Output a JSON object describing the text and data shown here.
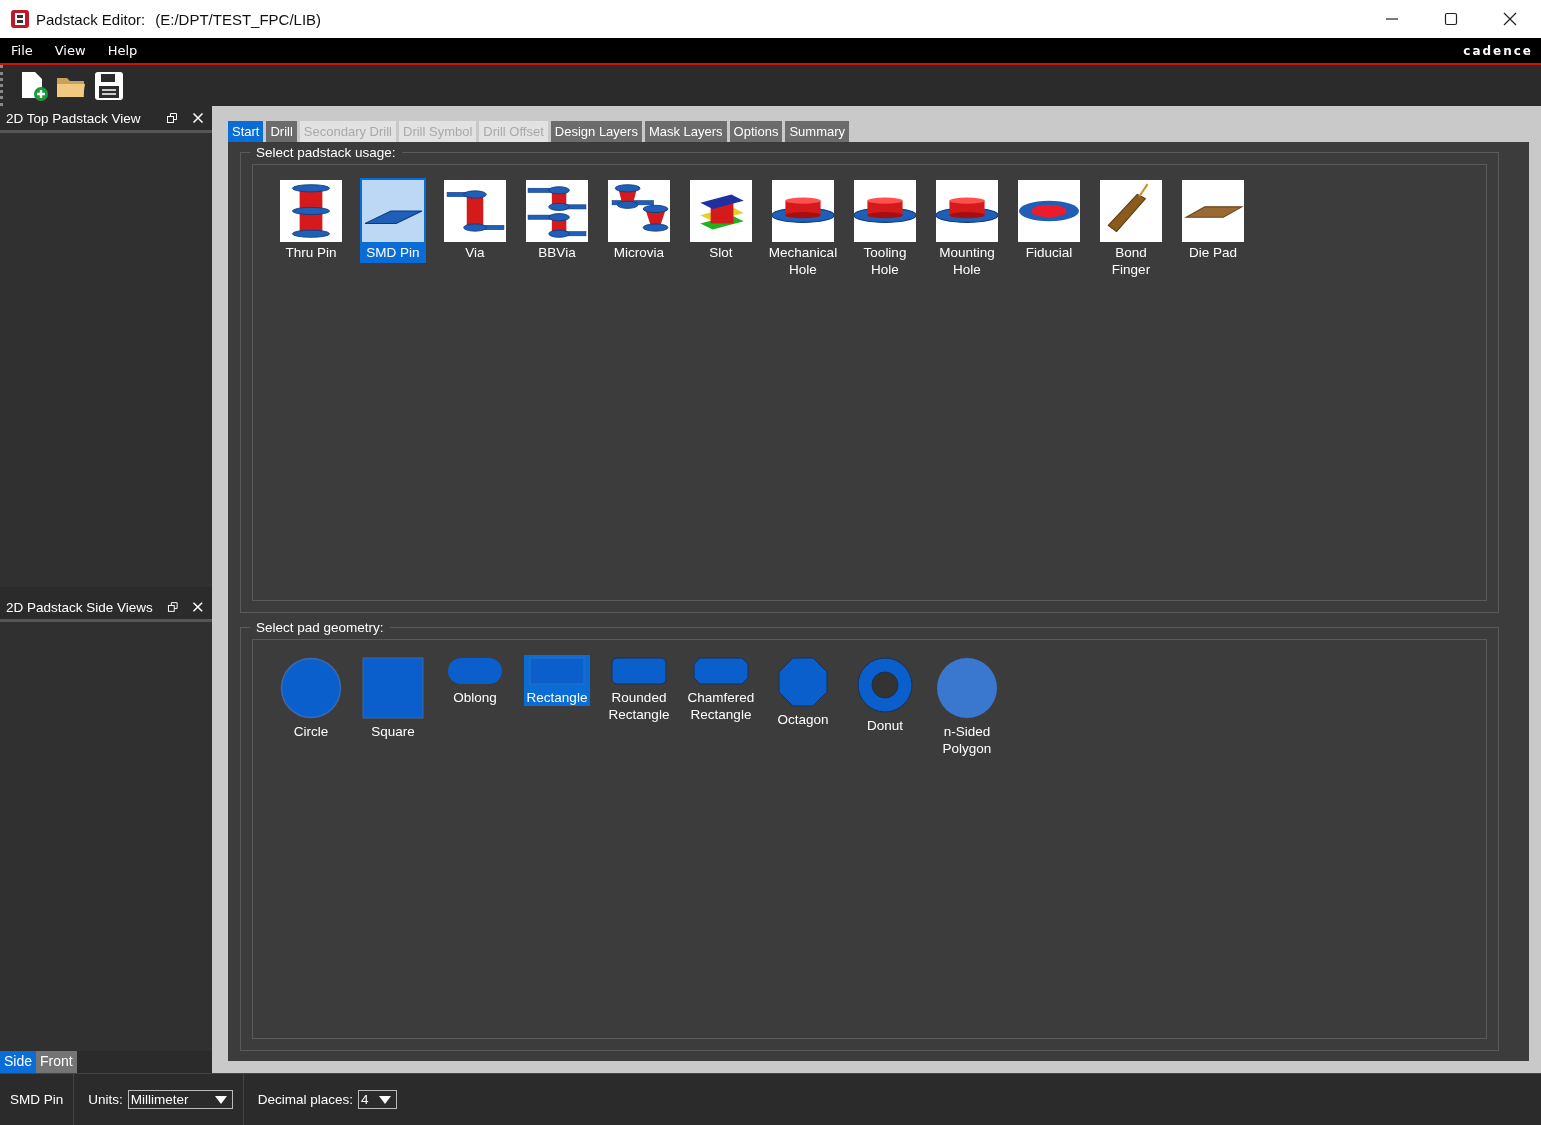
{
  "window": {
    "title": "Padstack Editor:",
    "path": "(E:/DPT/TEST_FPC/LIB)"
  },
  "menu": [
    "File",
    "View",
    "Help"
  ],
  "brand": "cadence",
  "left_panels": [
    {
      "title": "2D Top Padstack View"
    },
    {
      "title": "2D Padstack Side Views"
    }
  ],
  "view_tabs": [
    {
      "label": "Side",
      "selected": true
    },
    {
      "label": "Front",
      "selected": false
    }
  ],
  "tabs": [
    {
      "label": "Start",
      "selected": true,
      "disabled": false
    },
    {
      "label": "Drill",
      "selected": false,
      "disabled": false
    },
    {
      "label": "Secondary Drill",
      "selected": false,
      "disabled": true
    },
    {
      "label": "Drill Symbol",
      "selected": false,
      "disabled": true
    },
    {
      "label": "Drill Offset",
      "selected": false,
      "disabled": true
    },
    {
      "label": "Design Layers",
      "selected": false,
      "disabled": false
    },
    {
      "label": "Mask Layers",
      "selected": false,
      "disabled": false
    },
    {
      "label": "Options",
      "selected": false,
      "disabled": false
    },
    {
      "label": "Summary",
      "selected": false,
      "disabled": false
    }
  ],
  "usage": {
    "title": "Select padstack usage:",
    "items": [
      {
        "label": "Thru Pin",
        "kind": "thru-pin",
        "selected": false
      },
      {
        "label": "SMD Pin",
        "kind": "smd-pin",
        "selected": true
      },
      {
        "label": "Via",
        "kind": "via",
        "selected": false
      },
      {
        "label": "BBVia",
        "kind": "bbvia",
        "selected": false
      },
      {
        "label": "Microvia",
        "kind": "microvia",
        "selected": false
      },
      {
        "label": "Slot",
        "kind": "slot",
        "selected": false
      },
      {
        "label": "Mechanical Hole",
        "kind": "hole",
        "selected": false
      },
      {
        "label": "Tooling Hole",
        "kind": "hole",
        "selected": false
      },
      {
        "label": "Mounting Hole",
        "kind": "hole",
        "selected": false
      },
      {
        "label": "Fiducial",
        "kind": "fiducial",
        "selected": false
      },
      {
        "label": "Bond Finger",
        "kind": "bond-finger",
        "selected": false
      },
      {
        "label": "Die Pad",
        "kind": "die-pad",
        "selected": false
      }
    ]
  },
  "geometry": {
    "title": "Select pad geometry:",
    "items": [
      {
        "label": "Circle",
        "kind": "circle",
        "selected": false
      },
      {
        "label": "Square",
        "kind": "square",
        "selected": false
      },
      {
        "label": "Oblong",
        "kind": "oblong",
        "selected": false
      },
      {
        "label": "Rectangle",
        "kind": "rectangle",
        "selected": true
      },
      {
        "label": "Rounded Rectangle",
        "kind": "rounded-rectangle",
        "selected": false
      },
      {
        "label": "Chamfered Rectangle",
        "kind": "chamfered-rectangle",
        "selected": false
      },
      {
        "label": "Octagon",
        "kind": "octagon",
        "selected": false
      },
      {
        "label": "Donut",
        "kind": "donut",
        "selected": false
      },
      {
        "label": "n-Sided Polygon",
        "kind": "polygon",
        "selected": false
      }
    ]
  },
  "status_bar": {
    "usage": "SMD Pin",
    "units_label": "Units:",
    "units": "Millimeter",
    "decimal_label": "Decimal places:",
    "decimal_places": "4"
  }
}
